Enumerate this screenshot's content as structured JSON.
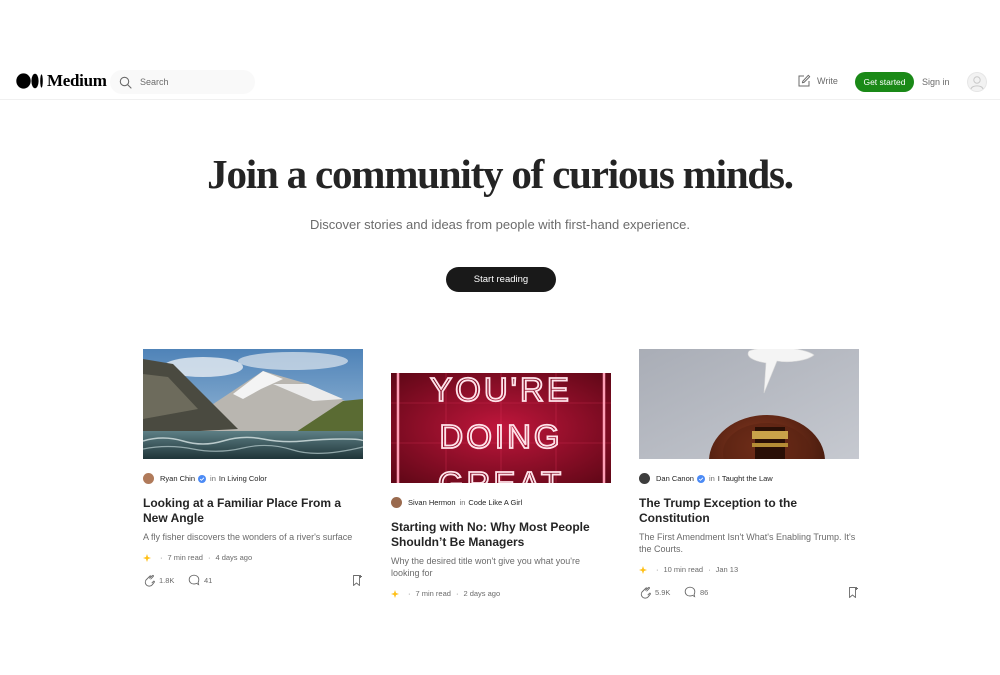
{
  "header": {
    "logo_text": "Medium",
    "search_placeholder": "Search",
    "write_label": "Write",
    "get_started_label": "Get started",
    "sign_in_label": "Sign in"
  },
  "hero": {
    "title": "Join a community of curious minds.",
    "subtitle": "Discover stories and ideas from people with first-hand experience.",
    "cta_label": "Start reading"
  },
  "colors": {
    "accent_green": "#1a8917",
    "cta_black": "#191919",
    "sparkle_yellow": "#ffc017",
    "verified_blue": "#4c8bf5"
  },
  "articles": [
    {
      "author": "Ryan Chin",
      "in_label": "in",
      "publication": "In Living Color",
      "verified": true,
      "title": "Looking at a Familiar Place From a New Angle",
      "subtitle": "A fly fisher discovers the wonders of a river's surface",
      "read_time": "7 min read",
      "date": "4 days ago",
      "claps": "1.8K",
      "responses": "41",
      "image": "mountain-river-photo"
    },
    {
      "author": "Sivan Hermon",
      "in_label": "in",
      "publication": "Code Like A Girl",
      "verified": false,
      "title": "Starting with No: Why Most People Shouldn’t Be Managers",
      "subtitle": "Why the desired title won't give you what you're looking for",
      "read_time": "7 min read",
      "date": "2 days ago",
      "image": "neon-sign-photo",
      "image_text": [
        "YOU'RE",
        "DOING",
        "GREAT"
      ]
    },
    {
      "author": "Dan Canon",
      "in_label": "in",
      "publication": "I Taught the Law",
      "verified": true,
      "title": "The Trump Exception to the Constitution",
      "subtitle": "The First Amendment Isn't What's Enabling Trump. It's the Courts.",
      "read_time": "10 min read",
      "date": "Jan 13",
      "claps": "5.9K",
      "responses": "86",
      "image": "gavel-speech-bubble-photo"
    }
  ],
  "icons": {
    "logo": "medium-logo-icon",
    "search": "search-icon",
    "write": "write-icon",
    "avatar": "user-avatar-icon",
    "sparkle": "sparkle-icon",
    "clap": "clap-icon",
    "response": "response-icon",
    "bookmark": "bookmark-icon",
    "verified": "verified-badge-icon"
  }
}
